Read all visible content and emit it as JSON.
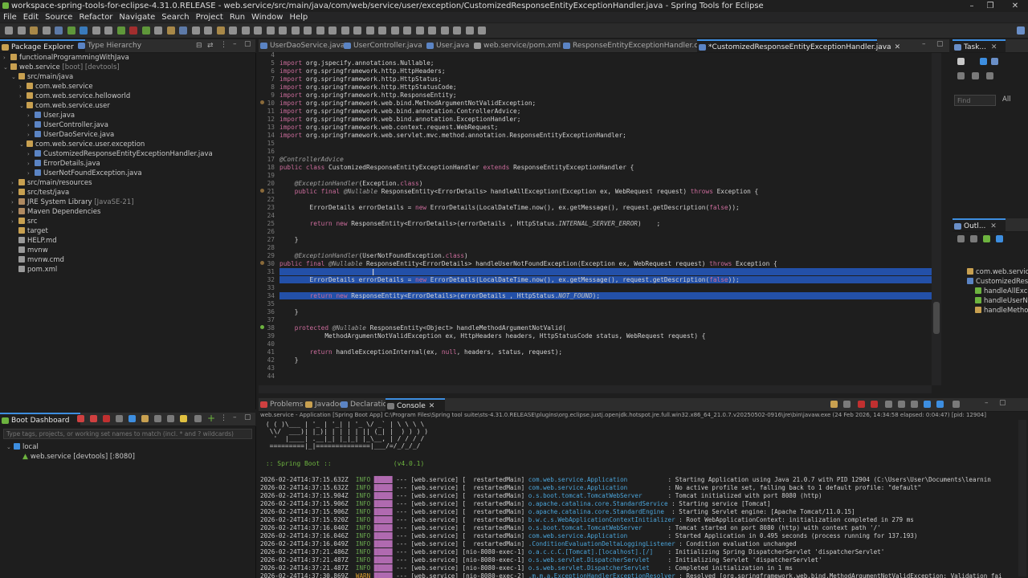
{
  "window": {
    "title": "workspace-spring-tools-for-eclipse-4.31.0.RELEASE - web.service/src/main/java/com/web/service/user/exception/CustomizedResponseEntityExceptionHandler.java - Spring Tools for Eclipse"
  },
  "menu": [
    "File",
    "Edit",
    "Source",
    "Refactor",
    "Navigate",
    "Search",
    "Project",
    "Run",
    "Window",
    "Help"
  ],
  "left_tabs": {
    "package_explorer": "Package Explorer",
    "type_hierarchy": "Type Hierarchy"
  },
  "tree": [
    {
      "label": "functionalProgrammingWithJava",
      "depth": 0,
      "twisty": "›"
    },
    {
      "label": "web.service",
      "extra": " [boot] [devtools]",
      "depth": 0,
      "twisty": "⌄"
    },
    {
      "label": "src/main/java",
      "depth": 1,
      "twisty": "⌄"
    },
    {
      "label": "com.web.service",
      "depth": 2,
      "twisty": "›"
    },
    {
      "label": "com.web.service.helloworld",
      "depth": 2,
      "twisty": "›"
    },
    {
      "label": "com.web.service.user",
      "depth": 2,
      "twisty": "⌄"
    },
    {
      "label": "User.java",
      "depth": 3,
      "twisty": "›"
    },
    {
      "label": "UserController.java",
      "depth": 3,
      "twisty": "›"
    },
    {
      "label": "UserDaoService.java",
      "depth": 3,
      "twisty": "›"
    },
    {
      "label": "com.web.service.user.exception",
      "depth": 2,
      "twisty": "⌄"
    },
    {
      "label": "CustomizedResponseEntityExceptionHandler.java",
      "depth": 3,
      "twisty": "›"
    },
    {
      "label": "ErrorDetails.java",
      "depth": 3,
      "twisty": "›"
    },
    {
      "label": "UserNotFoundException.java",
      "depth": 3,
      "twisty": "›"
    },
    {
      "label": "src/main/resources",
      "depth": 1,
      "twisty": "›"
    },
    {
      "label": "src/test/java",
      "depth": 1,
      "twisty": "›"
    },
    {
      "label": "JRE System Library",
      "extra": " [JavaSE-21]",
      "depth": 1,
      "twisty": "›"
    },
    {
      "label": "Maven Dependencies",
      "depth": 1,
      "twisty": "›"
    },
    {
      "label": "src",
      "depth": 1,
      "twisty": "›"
    },
    {
      "label": "target",
      "depth": 1,
      "twisty": ""
    },
    {
      "label": "HELP.md",
      "depth": 1,
      "twisty": ""
    },
    {
      "label": "mvnw",
      "depth": 1,
      "twisty": ""
    },
    {
      "label": "mvnw.cmd",
      "depth": 1,
      "twisty": ""
    },
    {
      "label": "pom.xml",
      "depth": 1,
      "twisty": ""
    }
  ],
  "editor_tabs": [
    {
      "label": "UserDaoService.java"
    },
    {
      "label": "UserController.java"
    },
    {
      "label": "User.java"
    },
    {
      "label": "web.service/pom.xml"
    },
    {
      "label": "ResponseEntityExceptionHandler.class"
    },
    {
      "label": "*CustomizedResponseEntityExceptionHandler.java",
      "active": true
    }
  ],
  "code": [
    {
      "n": "4",
      "t": ""
    },
    {
      "n": "5",
      "t": "import org.jspecify.annotations.Nullable;"
    },
    {
      "n": "6",
      "t": "import org.springframework.http.HttpHeaders;"
    },
    {
      "n": "7",
      "t": "import org.springframework.http.HttpStatus;"
    },
    {
      "n": "8",
      "t": "import org.springframework.http.HttpStatusCode;"
    },
    {
      "n": "9",
      "t": "import org.springframework.http.ResponseEntity;"
    },
    {
      "n": "10",
      "t": "import org.springframework.web.bind.MethodArgumentNotValidException;"
    },
    {
      "n": "11",
      "t": "import org.springframework.web.bind.annotation.ControllerAdvice;"
    },
    {
      "n": "12",
      "t": "import org.springframework.web.bind.annotation.ExceptionHandler;"
    },
    {
      "n": "13",
      "t": "import org.springframework.web.context.request.WebRequest;"
    },
    {
      "n": "14",
      "t": "import org.springframework.web.servlet.mvc.method.annotation.ResponseEntityExceptionHandler;"
    },
    {
      "n": "15",
      "t": ""
    },
    {
      "n": "16",
      "t": ""
    },
    {
      "n": "17",
      "t": "@ControllerAdvice"
    },
    {
      "n": "18",
      "t": "public class CustomizedResponseEntityExceptionHandler extends ResponseEntityExceptionHandler {"
    },
    {
      "n": "19",
      "t": ""
    },
    {
      "n": "20",
      "t": "    @ExceptionHandler(Exception.class)"
    },
    {
      "n": "21",
      "t": "    public final @Nullable ResponseEntity<ErrorDetails> handleAllException(Exception ex, WebRequest request) throws Exception {"
    },
    {
      "n": "22",
      "t": ""
    },
    {
      "n": "23",
      "t": "        ErrorDetails errorDetails = new ErrorDetails(LocalDateTime.now(), ex.getMessage(), request.getDescription(false));"
    },
    {
      "n": "24",
      "t": ""
    },
    {
      "n": "25",
      "t": "        return new ResponseEntity<ErrorDetails>(errorDetails , HttpStatus.INTERNAL_SERVER_ERROR)    ;"
    },
    {
      "n": "26",
      "t": ""
    },
    {
      "n": "27",
      "t": "    }"
    },
    {
      "n": "28",
      "t": ""
    },
    {
      "n": "29",
      "t": "    @ExceptionHandler(UserNotFoundException.class)"
    },
    {
      "n": "30",
      "t": "public final @Nullable ResponseEntity<ErrorDetails> handleUserNotFoundException(Exception ex, WebRequest request) throws Exception {"
    },
    {
      "n": "31",
      "t": "        ",
      "sel": true
    },
    {
      "n": "32",
      "t": "        ErrorDetails errorDetails = new ErrorDetails(LocalDateTime.now(), ex.getMessage(), request.getDescription(false));",
      "sel": true
    },
    {
      "n": "33",
      "t": "",
      "sel": true
    },
    {
      "n": "34",
      "t": "        return new ResponseEntity<ErrorDetails>(errorDetails , HttpStatus.NOT_FOUND);",
      "sel": true
    },
    {
      "n": "35",
      "t": ""
    },
    {
      "n": "36",
      "t": "    }"
    },
    {
      "n": "37",
      "t": ""
    },
    {
      "n": "38",
      "t": "    protected @Nullable ResponseEntity<Object> handleMethodArgumentNotValid("
    },
    {
      "n": "39",
      "t": "            MethodArgumentNotValidException ex, HttpHeaders headers, HttpStatusCode status, WebRequest request) {"
    },
    {
      "n": "40",
      "t": ""
    },
    {
      "n": "41",
      "t": "        return handleExceptionInternal(ex, null, headers, status, request);"
    },
    {
      "n": "42",
      "t": "    }"
    },
    {
      "n": "43",
      "t": ""
    },
    {
      "n": "44",
      "t": ""
    }
  ],
  "right_top": {
    "tab": "Task...",
    "find_placeholder": "Find",
    "all_label": "All"
  },
  "outline": {
    "tab": "Outl...",
    "items": [
      "com.web.servic",
      "CustomizedResp",
      "handleAllExce",
      "handleUserNo",
      "handleMethod"
    ]
  },
  "boot_dashboard": {
    "tab": "Boot Dashboard",
    "filter_placeholder": "Type tags, projects, or working set names to match (incl. * and ? wildcards)",
    "local": "local",
    "app": "web.service [devtools] [:8080]"
  },
  "bottom_tabs": [
    {
      "label": "Problems"
    },
    {
      "label": "Javadoc"
    },
    {
      "label": "Declaration"
    },
    {
      "label": "Console",
      "active": true
    }
  ],
  "console": {
    "header": "web.service - Application [Spring Boot App] C:\\Program Files\\Spring tool suite\\sts-4.31.0.RELEASE\\plugins\\org.eclipse.justj.openjdk.hotspot.jre.full.win32.x86_64_21.0.7.v20250502-0916\\jre\\bin\\javaw.exe  (24 Feb 2026, 14:34:58 elapsed: 0:04:47) [pid: 12904]",
    "banner": [
      " ( ( )\\___ | '_ | '_| | '_ \\/ _` | \\ \\ \\ \\",
      "  \\\\/  ___)| |_)| | | | | || (_| |  ) ) ) )",
      "   '  |____| .__|_| |_|_| |_\\__, | / / / /",
      "  =========|_|==============|___/=/_/_/_/"
    ],
    "spring_boot": " :: Spring Boot ::                (v4.0.1)",
    "logs": [
      {
        "ts": "2026-02-24T14:37:15.632Z",
        "lvl": "INFO",
        "thr": "--- [web.service] [  restartedMain]",
        "cls": "com.web.service.Application          ",
        "msg": ": Starting Application using Java 21.0.7 with PID 12904 (C:\\Users\\User\\Documents\\learnin"
      },
      {
        "ts": "2026-02-24T14:37:15.632Z",
        "lvl": "INFO",
        "thr": "--- [web.service] [  restartedMain]",
        "cls": "com.web.service.Application          ",
        "msg": ": No active profile set, falling back to 1 default profile: \"default\""
      },
      {
        "ts": "2026-02-24T14:37:15.904Z",
        "lvl": "INFO",
        "thr": "--- [web.service] [  restartedMain]",
        "cls": "o.s.boot.tomcat.TomcatWebServer      ",
        "msg": ": Tomcat initialized with port 8080 (http)"
      },
      {
        "ts": "2026-02-24T14:37:15.906Z",
        "lvl": "INFO",
        "thr": "--- [web.service] [  restartedMain]",
        "cls": "o.apache.catalina.core.StandardService",
        "msg": ": Starting service [Tomcat]"
      },
      {
        "ts": "2026-02-24T14:37:15.906Z",
        "lvl": "INFO",
        "thr": "--- [web.service] [  restartedMain]",
        "cls": "o.apache.catalina.core.StandardEngine ",
        "msg": ": Starting Servlet engine: [Apache Tomcat/11.0.15]"
      },
      {
        "ts": "2026-02-24T14:37:15.920Z",
        "lvl": "INFO",
        "thr": "--- [web.service] [  restartedMain]",
        "cls": "b.w.c.s.WebApplicationContextInitializer",
        "msg": ": Root WebApplicationContext: initialization completed in 279 ms"
      },
      {
        "ts": "2026-02-24T14:37:16.040Z",
        "lvl": "INFO",
        "thr": "--- [web.service] [  restartedMain]",
        "cls": "o.s.boot.tomcat.TomcatWebServer      ",
        "msg": ": Tomcat started on port 8080 (http) with context path '/'"
      },
      {
        "ts": "2026-02-24T14:37:16.046Z",
        "lvl": "INFO",
        "thr": "--- [web.service] [  restartedMain]",
        "cls": "com.web.service.Application          ",
        "msg": ": Started Application in 0.495 seconds (process running for 137.193)"
      },
      {
        "ts": "2026-02-24T14:37:16.049Z",
        "lvl": "INFO",
        "thr": "--- [web.service] [  restartedMain]",
        "cls": ".ConditionEvaluationDeltaLoggingListener",
        "msg": ": Condition evaluation unchanged"
      },
      {
        "ts": "2026-02-24T14:37:21.486Z",
        "lvl": "INFO",
        "thr": "--- [web.service] [nio-8080-exec-1]",
        "cls": "o.a.c.c.C.[Tomcat].[localhost].[/]   ",
        "msg": ": Initializing Spring DispatcherServlet 'dispatcherServlet'"
      },
      {
        "ts": "2026-02-24T14:37:21.487Z",
        "lvl": "INFO",
        "thr": "--- [web.service] [nio-8080-exec-1]",
        "cls": "o.s.web.servlet.DispatcherServlet    ",
        "msg": ": Initializing Servlet 'dispatcherServlet'"
      },
      {
        "ts": "2026-02-24T14:37:21.487Z",
        "lvl": "INFO",
        "thr": "--- [web.service] [nio-8080-exec-1]",
        "cls": "o.s.web.servlet.DispatcherServlet    ",
        "msg": ": Completed initialization in 1 ms"
      },
      {
        "ts": "2026-02-24T14:37:30.869Z",
        "lvl": "WARN",
        "thr": "--- [web.service] [nio-8080-exec-2]",
        "cls": ".m.m.a.ExceptionHandlerExceptionResolver",
        "msg": ": Resolved [org.springframework.web.bind.MethodArgumentNotValidException: Validation fai"
      }
    ]
  },
  "colors": {
    "accent": "#3d8ee0",
    "selection": "#2350a8",
    "info": "#6aa84f",
    "warn": "#e0a030",
    "spring": "#6db33f"
  }
}
